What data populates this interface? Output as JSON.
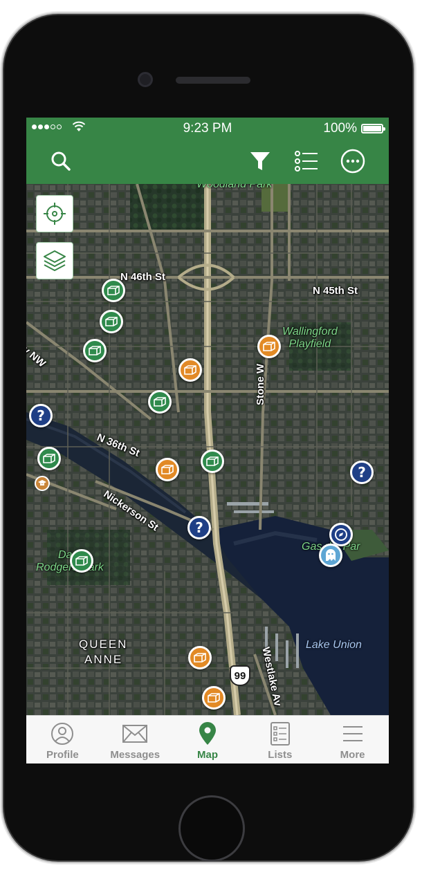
{
  "status_bar": {
    "time": "9:23 PM",
    "battery": "100%"
  },
  "toolbar": {
    "search_icon": "search-icon",
    "filter_icon": "filter-icon",
    "list_icon": "list-icon",
    "more_icon": "more-options-icon",
    "color": "#378546"
  },
  "map": {
    "controls": [
      "locate-icon",
      "layers-icon"
    ],
    "street_labels": {
      "n46": "N 46th St",
      "n45": "N 45th St",
      "n36": "N 36th St",
      "nickerson": "Nickerson St",
      "stone": "Stone W",
      "westlake": "Westlake Av",
      "way_nw": "ay NW",
      "route": "99"
    },
    "park_labels": {
      "woodland": "Woodland Park",
      "wallingford": "Wallingford\nPlayfield",
      "gasworks": "Gas  rks Par",
      "rodgers_1": "Da   l",
      "rodgers_2": "Rodgers Park"
    },
    "district_labels": {
      "queen_anne_1": "QUEEN",
      "queen_anne_2": "ANNE"
    },
    "water_labels": {
      "lake_union": "Lake Union"
    },
    "marker_colors": {
      "green": "#2f8a4c",
      "orange": "#e28a26",
      "blue": "#1f3f86",
      "lightblue": "#5ea6d4"
    },
    "question_mark": "?"
  },
  "tab_bar": {
    "tabs": [
      {
        "label": "Profile",
        "icon": "profile-icon"
      },
      {
        "label": "Messages",
        "icon": "envelope-icon"
      },
      {
        "label": "Map",
        "icon": "map-pin-icon"
      },
      {
        "label": "Lists",
        "icon": "checklist-icon"
      },
      {
        "label": "More",
        "icon": "hamburger-icon"
      }
    ],
    "active_color": "#378546"
  }
}
